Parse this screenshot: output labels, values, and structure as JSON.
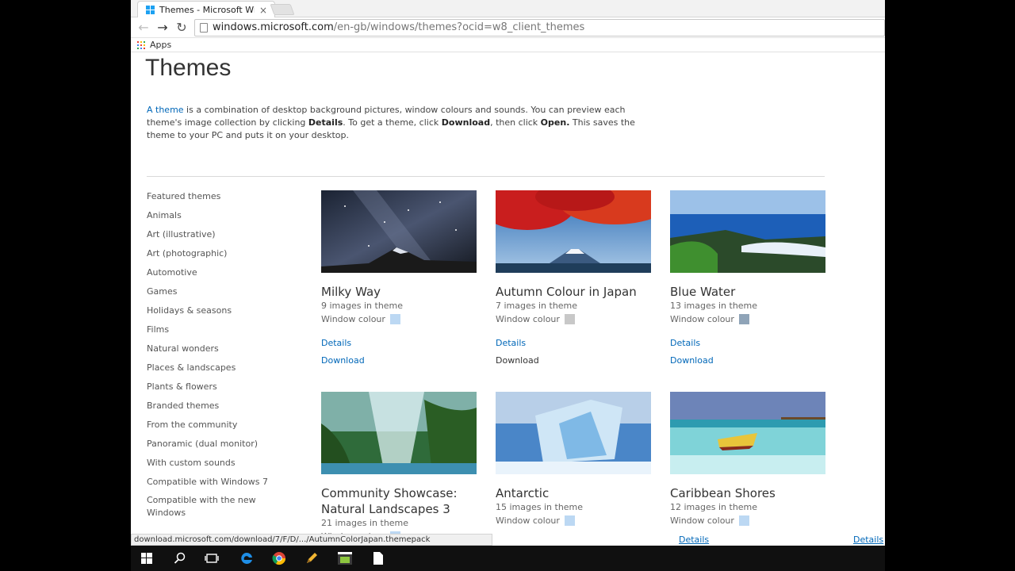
{
  "browser": {
    "tab_title": "Themes - Microsoft Windo",
    "tab_close": "×",
    "url_host": "windows.microsoft.com",
    "url_path": "/en-gb/windows/themes?ocid=w8_client_themes",
    "bookmarks_apps": "Apps",
    "status_url": "download.microsoft.com/download/7/F/D/.../AutumnColorJapan.themepack"
  },
  "page": {
    "title": "Themes",
    "intro": {
      "link": "A theme",
      "t1": " is a combination of desktop background pictures, window colours and sounds. You can preview each theme's image collection by clicking ",
      "b1": "Details",
      "t2": ". To get a theme, click ",
      "b2": "Download",
      "t3": ", then click ",
      "b3": "Open.",
      "t4": " This saves the theme to your PC and puts it on your desktop."
    },
    "sidebar": [
      "Featured themes",
      "Animals",
      "Art (illustrative)",
      "Art (photographic)",
      "Automotive",
      "Games",
      "Holidays & seasons",
      "Films",
      "Natural wonders",
      "Places & landscapes",
      "Plants & flowers",
      "Branded themes",
      "From the community",
      "Panoramic (dual monitor)",
      "With custom sounds",
      "Compatible with Windows 7",
      "Compatible with the new Windows"
    ],
    "window_colour_label": "Window colour",
    "details_label": "Details",
    "download_label": "Download",
    "themes": [
      {
        "title": "Milky Way",
        "images": "9 images in theme",
        "swatch": "#bcd8f3"
      },
      {
        "title": "Autumn Colour in Japan",
        "images": "7 images in theme",
        "swatch": "#c8c8c8"
      },
      {
        "title": "Blue Water",
        "images": "13 images in theme",
        "swatch": "#8fa4b8"
      },
      {
        "title": "Community Showcase: Natural Landscapes 3",
        "images": "21 images in theme",
        "swatch": "#bcd8f3"
      },
      {
        "title": "Antarctic",
        "images": "15 images in theme",
        "swatch": "#bcd8f3"
      },
      {
        "title": "Caribbean Shores",
        "images": "12 images in theme",
        "swatch": "#bcd8f3"
      }
    ]
  },
  "colors": {
    "link": "#0067b8",
    "taskbar": "#101010"
  }
}
